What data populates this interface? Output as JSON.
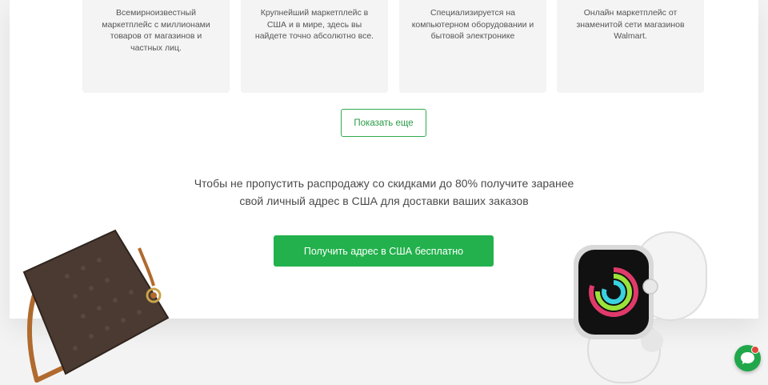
{
  "cards": [
    {
      "text": "Всемирноизвестный маркетплейс с миллионами товаров от магазинов и частных лиц."
    },
    {
      "text": "Крупнейший маркетплейс в США и в мире, здесь вы найдете точно абсолютно все."
    },
    {
      "text": "Специализируется на компьютерном оборудовании и бытовой электронике"
    },
    {
      "text": "Онлайн маркетплейс от знаменитой сети магазинов Walmart."
    }
  ],
  "show_more_label": "Показать еще",
  "promo_text": "Чтобы не пропустить распродажу со скидками до 80% получите заранее свой личный адрес в США для доставки ваших заказов",
  "cta_label": "Получить адрес в США бесплатно",
  "colors": {
    "accent": "#22b14c",
    "chat_badge": "#e0463c"
  },
  "icons": {
    "chat": "chat-bubble-icon"
  }
}
